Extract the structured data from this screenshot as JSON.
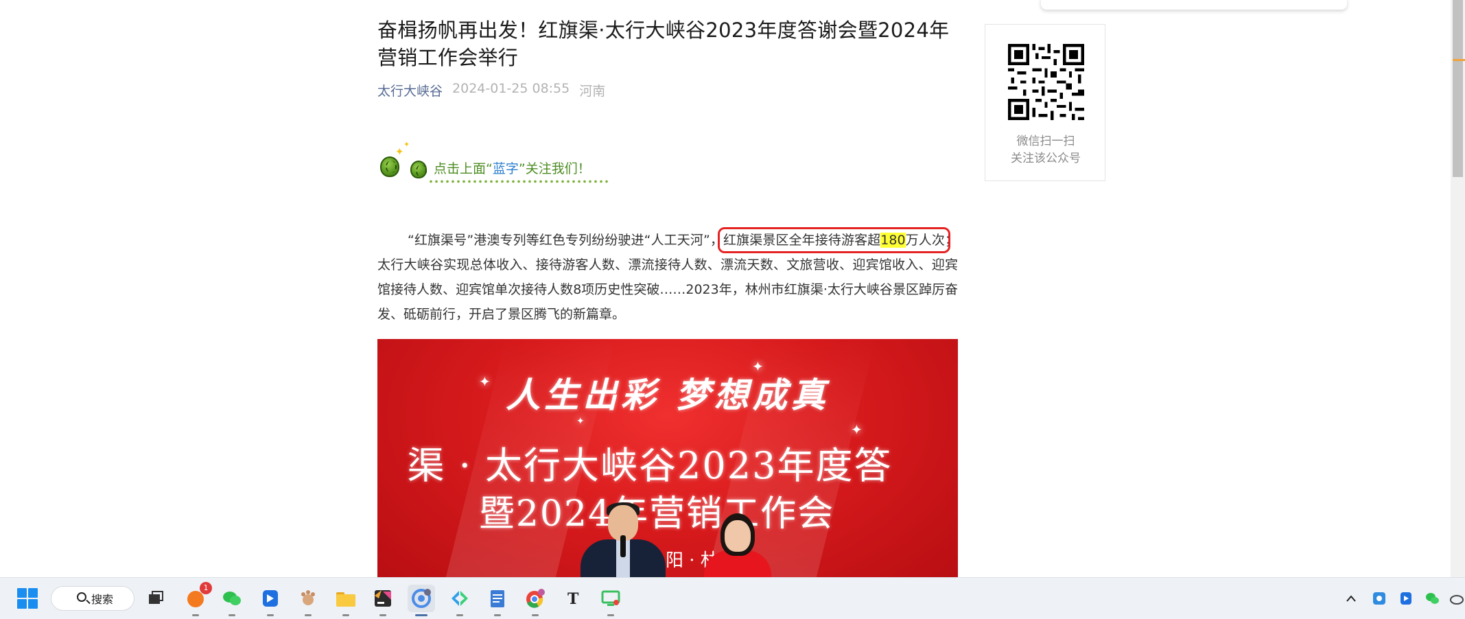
{
  "article": {
    "title": "奋楫扬帆再出发！红旗渠·太行大峡谷2023年度答谢会暨2024年营销工作会举行",
    "author": "太行大峡谷",
    "datetime": "2024-01-25 08:55",
    "region": "河南",
    "follow": {
      "prefix": "点击上面“",
      "blue_word": "蓝字",
      "suffix": "”关注我们！"
    },
    "paragraph": {
      "lead": "“红旗渠号”港澳专列等红色专列纷纷驶进“人工天河”，",
      "boxed_before": "红旗渠景区全年接待游客超",
      "boxed_highlight": "180",
      "boxed_after": "万人次",
      "rest": "；太行大峡谷实现总体收入、接待游客人数、漂流接待人数、漂流天数、文旅营收、迎宾馆收入、迎宾馆接待人数、迎宾馆单次接待人数8项历史性突破……2023年，林州市红旗渠·太行大峡谷景区踔厉奋发、砥砺前行，开启了景区腾飞的新篇章。"
    },
    "photo": {
      "line1": "人生出彩 梦想成真",
      "line2": "渠 · 太行大峡谷2023年度答",
      "line3": "暨2024年营销工作会",
      "line4": "阳 · 林"
    }
  },
  "sidebar": {
    "qr_caption_line1": "微信扫一扫",
    "qr_caption_line2": "关注该公众号"
  },
  "taskbar": {
    "search_label": "搜索",
    "notification_count": "1",
    "accent": "#1a8df0"
  },
  "colors": {
    "link": "#576b95",
    "highlight_box": "#e62323",
    "highlight_fill": "#ffff33",
    "follow_green": "#4d8c22",
    "follow_blue": "#2d7fd0"
  }
}
